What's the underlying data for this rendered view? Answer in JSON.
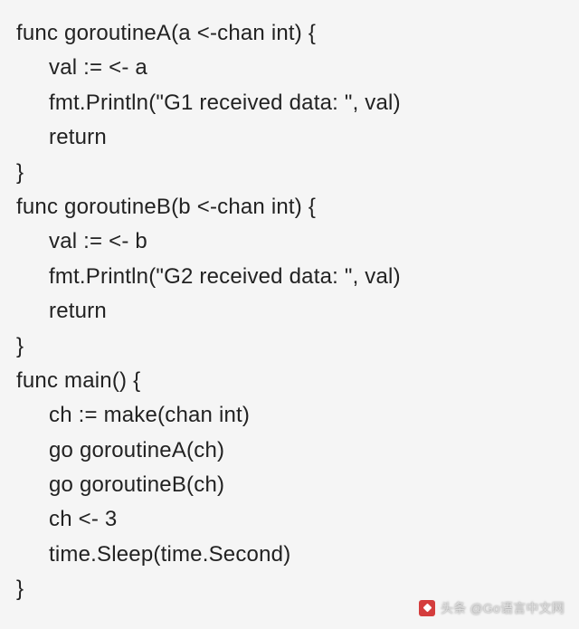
{
  "code": {
    "lines": [
      {
        "text": "func goroutineA(a <-chan int) {",
        "indent": 0
      },
      {
        "text": "val := <- a",
        "indent": 1
      },
      {
        "text": "fmt.Println(\"G1 received data: \", val)",
        "indent": 1
      },
      {
        "text": "return",
        "indent": 1
      },
      {
        "text": "}",
        "indent": 0
      },
      {
        "text": "func goroutineB(b <-chan int) {",
        "indent": 0
      },
      {
        "text": "val := <- b",
        "indent": 1
      },
      {
        "text": "fmt.Println(\"G2 received data: \", val)",
        "indent": 1
      },
      {
        "text": "return",
        "indent": 1
      },
      {
        "text": "}",
        "indent": 0
      },
      {
        "text": "func main() {",
        "indent": 0
      },
      {
        "text": "ch := make(chan int)",
        "indent": 1
      },
      {
        "text": "go goroutineA(ch)",
        "indent": 1
      },
      {
        "text": "go goroutineB(ch)",
        "indent": 1
      },
      {
        "text": "ch <- 3",
        "indent": 1
      },
      {
        "text": "time.Sleep(time.Second)",
        "indent": 1
      },
      {
        "text": "}",
        "indent": 0
      }
    ]
  },
  "watermark": {
    "text": "头条 @Go语言中文网"
  }
}
